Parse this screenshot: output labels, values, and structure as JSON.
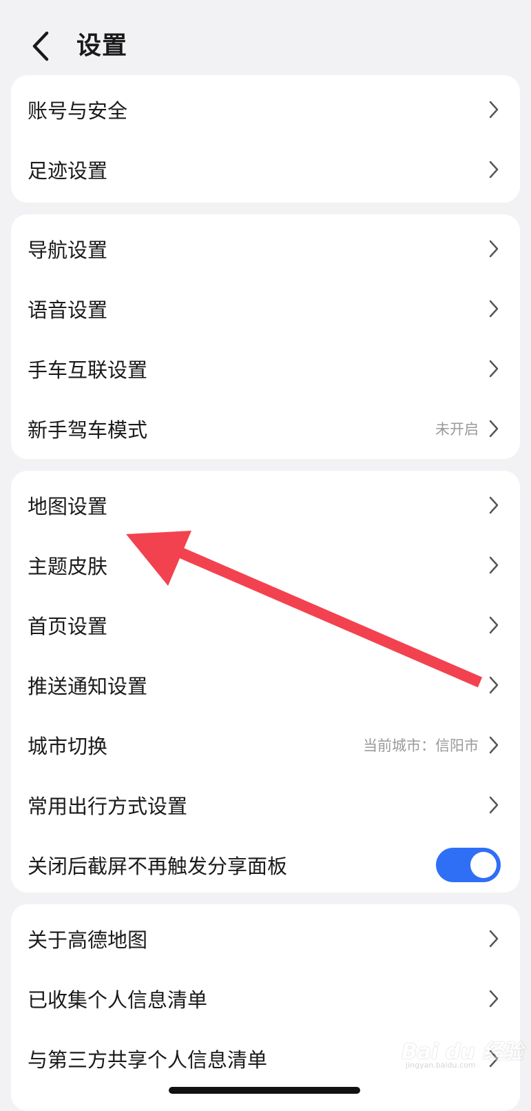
{
  "header": {
    "title": "设置",
    "back_icon": "chevron-left-icon"
  },
  "groups": [
    {
      "items": [
        {
          "label": "账号与安全"
        },
        {
          "label": "足迹设置"
        }
      ]
    },
    {
      "items": [
        {
          "label": "导航设置"
        },
        {
          "label": "语音设置"
        },
        {
          "label": "手车互联设置"
        },
        {
          "label": "新手驾车模式",
          "value": "未开启"
        }
      ]
    },
    {
      "items": [
        {
          "label": "地图设置"
        },
        {
          "label": "主题皮肤"
        },
        {
          "label": "首页设置"
        },
        {
          "label": "推送通知设置"
        },
        {
          "label": "城市切换",
          "value": "当前城市：信阳市"
        },
        {
          "label": "常用出行方式设置"
        },
        {
          "label": "关闭后截屏不再触发分享面板",
          "toggle": true
        }
      ]
    },
    {
      "items": [
        {
          "label": "关于高德地图"
        },
        {
          "label": "已收集个人信息清单"
        },
        {
          "label": "与第三方共享个人信息清单"
        }
      ]
    }
  ],
  "annotation": {
    "arrow_color": "#f3424f",
    "points_to": "地图设置"
  },
  "colors": {
    "toggle_on": "#2f6ff6",
    "background": "#f2f2f4"
  },
  "watermark": {
    "text": "Bai du 经验",
    "sub": "jingyan.baidu.com"
  }
}
